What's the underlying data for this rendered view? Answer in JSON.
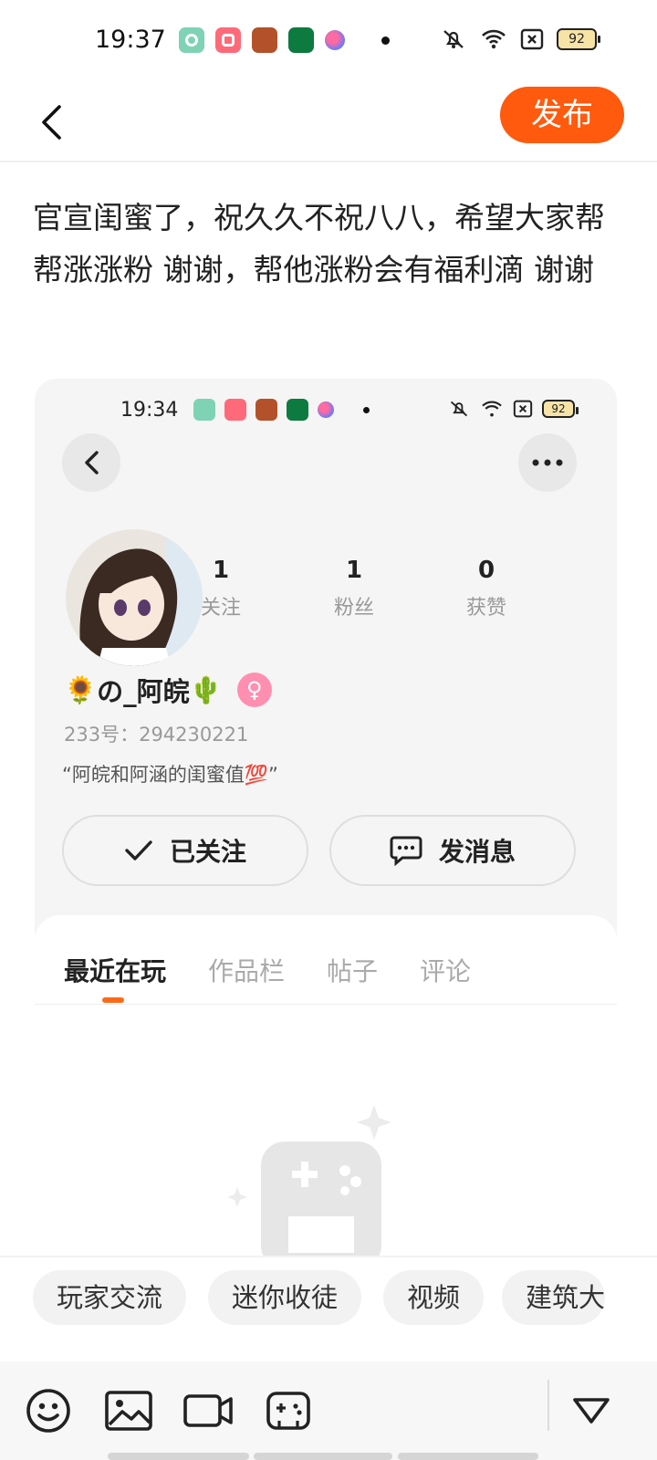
{
  "status_bar": {
    "time": "19:37",
    "battery": "92"
  },
  "header": {
    "publish_label": "发布"
  },
  "post": {
    "text": "官宣闺蜜了，祝久久不祝八八，希望大家帮帮涨涨粉 谢谢，帮他涨粉会有福利滴 谢谢"
  },
  "embedded_profile": {
    "status_time": "19:34",
    "status_battery": "92",
    "stats": [
      {
        "value": "1",
        "label": "关注"
      },
      {
        "value": "1",
        "label": "粉丝"
      },
      {
        "value": "0",
        "label": "获赞"
      }
    ],
    "nickname_prefix": "🌻",
    "nickname": "の_阿皖",
    "nickname_suffix": "🌵",
    "uid_label": "233号：294230221",
    "bio": "“阿皖和阿涵的闺蜜值💯”",
    "follow_label": "已关注",
    "message_label": "发消息",
    "tabs": [
      "最近在玩",
      "作品栏",
      "帖子",
      "评论"
    ]
  },
  "topic_chips": [
    "玩家交流",
    "迷你收徒",
    "视频",
    "建筑大"
  ],
  "colors": {
    "accent": "#ff5a0d",
    "gender": "#ff8fb0"
  },
  "icons": {
    "toolbar": [
      "emoji-icon",
      "image-icon",
      "video-icon",
      "gamepad-icon",
      "collapse-icon"
    ]
  }
}
